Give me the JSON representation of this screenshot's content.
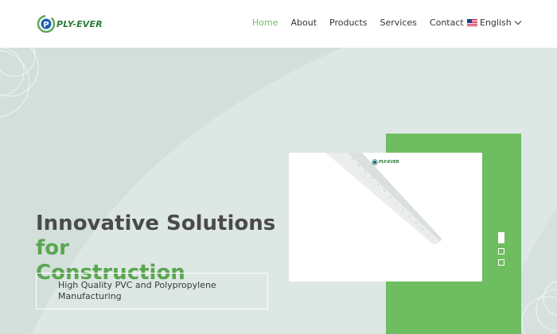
{
  "brand": {
    "name": "PLY-EVER",
    "colors": {
      "green": "#6ebd60",
      "dark_green": "#2a7a3a",
      "blue": "#1f5fb0"
    }
  },
  "nav": {
    "items": [
      {
        "label": "Home",
        "active": true
      },
      {
        "label": "About",
        "active": false
      },
      {
        "label": "Products",
        "active": false
      },
      {
        "label": "Services",
        "active": false
      },
      {
        "label": "Contact",
        "active": false
      }
    ],
    "language": {
      "label": "English",
      "flag_icon": "us-flag-icon",
      "dropdown_icon": "chevron-down-icon"
    }
  },
  "hero": {
    "headline_part1": "Innovative Solutions ",
    "headline_accent1": "for",
    "headline_accent2": "Construction",
    "subtitle": "High Quality PVC and Polypropylene Manufacturing",
    "product_image": {
      "description_icon": "corner-bead-product-image",
      "watermark": "PLY-EVER"
    },
    "slider": {
      "slides": 3,
      "active_slide": 1
    }
  }
}
